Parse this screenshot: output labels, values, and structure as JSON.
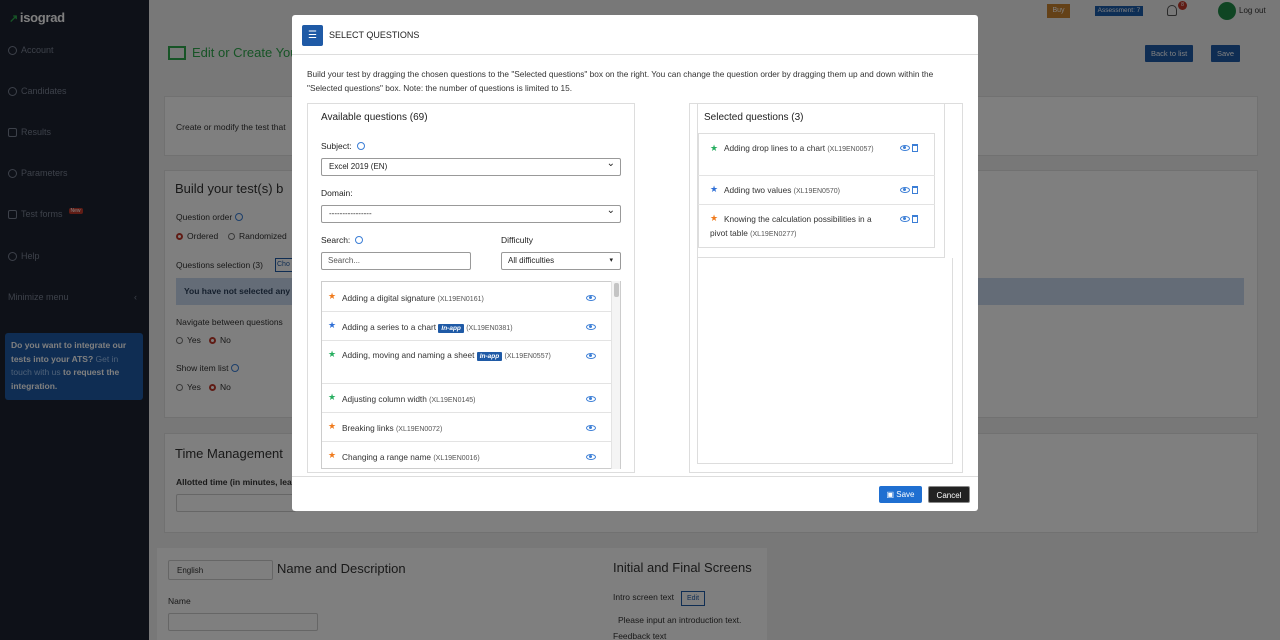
{
  "colors": {
    "sidebar": "#1d2330",
    "brand_green": "#2ea84d",
    "primary_blue": "#1f5aa6",
    "star_orange": "#f07b1d",
    "star_green": "#27ae60",
    "star_blue": "#2f6fd6"
  },
  "sidebar": {
    "logo": "isograd",
    "items": [
      {
        "label": "Account",
        "icon": "info-circle-icon"
      },
      {
        "label": "Candidates",
        "icon": "user-icon"
      },
      {
        "label": "Results",
        "icon": "bar-chart-icon"
      },
      {
        "label": "Parameters",
        "icon": "gear-icon"
      },
      {
        "label": "Test forms",
        "icon": "edit-icon",
        "badge": "New"
      },
      {
        "label": "Help",
        "icon": "help-circle-icon"
      },
      {
        "label": "Minimize menu",
        "icon": "chevron-left-icon"
      }
    ],
    "promo": {
      "text": "Do you want to integrate our tests into your ATS?",
      "link": "Get in touch with us",
      "tail": "to request the integration."
    }
  },
  "topbar": {
    "buy": "Buy",
    "assessment": "Assessment: 7",
    "notif_count": "8",
    "logout": "Log out"
  },
  "page": {
    "title": "Edit or Create You",
    "back_to_list": "Back to list",
    "save": "Save",
    "intro": "Create or modify the test that",
    "build_title": "Build your test(s) b",
    "question_order_label": "Question order",
    "ordered": "Ordered",
    "randomized": "Randomized",
    "questions_selection": "Questions selection (3)",
    "choose_btn": "Cho",
    "alert": "You have not selected any",
    "navigate_label": "Navigate between questions",
    "yes": "Yes",
    "no": "No",
    "show_item_list": "Show item list",
    "time_mgmt": "Time Management",
    "allotted_time": "Allotted time (in minutes, leav",
    "language": "English",
    "name_desc_title": "Name and Description",
    "name_label": "Name",
    "screens_title": "Initial and Final Screens",
    "intro_screen_label": "Intro screen text",
    "edit": "Edit",
    "intro_placeholder": "Please input an introduction text.",
    "feedback_label": "Feedback text"
  },
  "modal": {
    "title": "SELECT QUESTIONS",
    "description": "Build your test by dragging the chosen questions to the \"Selected questions\" box on the right. You can change the question order by dragging them up and down within the \"Selected questions\" box. Note: the number of questions is limited to 15.",
    "available_title": "Available questions (69)",
    "subject_label": "Subject:",
    "subject_value": "Excel 2019 (EN)",
    "domain_label": "Domain:",
    "domain_value": "----------------",
    "search_label": "Search:",
    "search_placeholder": "Search...",
    "difficulty_label": "Difficulty",
    "difficulty_value": "All difficulties",
    "available": [
      {
        "title": "Adding a digital signature",
        "code": "(XL19EN0161)",
        "difficulty": "orange",
        "inapp": ""
      },
      {
        "title": "Adding a series to a chart",
        "code": "(XL19EN0381)",
        "difficulty": "blue",
        "inapp": "In-app"
      },
      {
        "title": "Adding, moving and naming a sheet",
        "code": "(XL19EN0557)",
        "difficulty": "green",
        "inapp": "In-app"
      },
      {
        "title": "Adjusting column width",
        "code": "(XL19EN0145)",
        "difficulty": "green",
        "inapp": ""
      },
      {
        "title": "Breaking links",
        "code": "(XL19EN0072)",
        "difficulty": "orange",
        "inapp": ""
      },
      {
        "title": "Changing a range name",
        "code": "(XL19EN0016)",
        "difficulty": "orange",
        "inapp": ""
      }
    ],
    "selected_title": "Selected questions (3)",
    "selected": [
      {
        "title": "Adding drop lines to a chart",
        "code": "(XL19EN0057)",
        "difficulty": "green"
      },
      {
        "title": "Adding two values",
        "code": "(XL19EN0570)",
        "difficulty": "blue"
      },
      {
        "title": "Knowing the calculation possibilities in a pivot table",
        "code": "(XL19EN0277)",
        "difficulty": "orange"
      }
    ],
    "save": "Save",
    "cancel": "Cancel"
  }
}
